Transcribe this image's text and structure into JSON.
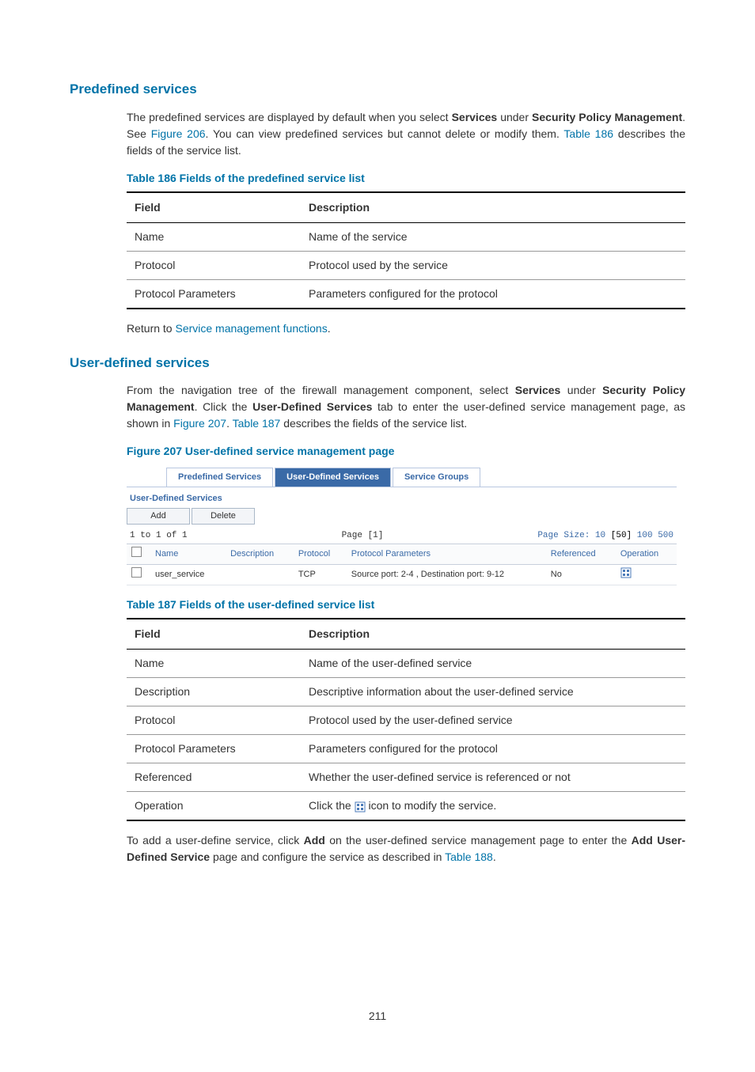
{
  "section1": {
    "heading": "Predefined services",
    "para_parts": {
      "t1": "The predefined services are displayed by default when you select ",
      "b1": "Services",
      "t2": " under ",
      "b2": "Security Policy Management",
      "t3": ". See ",
      "l1": "Figure 206",
      "t4": ". You can view predefined services but cannot delete or modify them. ",
      "l2": "Table 186",
      "t5": " describes the fields of the service list."
    },
    "table_caption": "Table 186 Fields of the predefined service list",
    "headers": {
      "c1": "Field",
      "c2": "Description"
    },
    "rows": [
      {
        "c1": "Name",
        "c2": "Name of the service"
      },
      {
        "c1": "Protocol",
        "c2": "Protocol used by the service"
      },
      {
        "c1": "Protocol Parameters",
        "c2": "Parameters configured for the protocol"
      }
    ],
    "return": {
      "t1": "Return to ",
      "l1": "Service management functions",
      "t2": "."
    }
  },
  "section2": {
    "heading": "User-defined services",
    "para_parts": {
      "t1": "From the navigation tree of the firewall management component, select ",
      "b1": "Services",
      "t2": " under ",
      "b2": "Security Policy Management",
      "t3": ". Click the ",
      "b3": "User-Defined Services",
      "t4": " tab to enter the user-defined service management page, as shown in ",
      "l1": "Figure 207",
      "t5": ". ",
      "l2": "Table 187",
      "t6": " describes the fields of the service list."
    },
    "figure_caption": "Figure 207 User-defined service management page",
    "figure": {
      "tabs": {
        "t1": "Predefined Services",
        "t2": "User-Defined Services",
        "t3": "Service Groups"
      },
      "panel_label": "User-Defined Services",
      "buttons": {
        "add": "Add",
        "delete": "Delete"
      },
      "pager": {
        "left": "1 to 1 of 1",
        "center": "Page [1]",
        "right_label": "Page Size: ",
        "r10": "10",
        "r50": "[50]",
        "r100": "100",
        "r500": "500"
      },
      "headers": {
        "name": "Name",
        "desc": "Description",
        "proto": "Protocol",
        "params": "Protocol Parameters",
        "ref": "Referenced",
        "op": "Operation"
      },
      "row": {
        "name": "user_service",
        "desc": "",
        "proto": "TCP",
        "params": "Source port: 2-4 , Destination port: 9-12",
        "ref": "No"
      }
    },
    "table_caption": "Table 187 Fields of the user-defined service list",
    "headers": {
      "c1": "Field",
      "c2": "Description"
    },
    "rows": [
      {
        "c1": "Name",
        "c2": "Name of the user-defined service"
      },
      {
        "c1": "Description",
        "c2": "Descriptive information about the user-defined service"
      },
      {
        "c1": "Protocol",
        "c2": "Protocol used by the user-defined service"
      },
      {
        "c1": "Protocol Parameters",
        "c2": "Parameters configured for the protocol"
      },
      {
        "c1": "Referenced",
        "c2": "Whether the user-defined service is referenced or not"
      }
    ],
    "op_row": {
      "c1": "Operation",
      "pre": "Click the ",
      "post": " icon to modify the service."
    },
    "para2": {
      "t1": "To add a user-define service, click ",
      "b1": "Add",
      "t2": " on the user-defined service management page to enter the ",
      "b2": "Add User-Defined Service",
      "t3": " page and configure the service as described in ",
      "l1": "Table 188",
      "t4": "."
    }
  },
  "page_number": "211"
}
